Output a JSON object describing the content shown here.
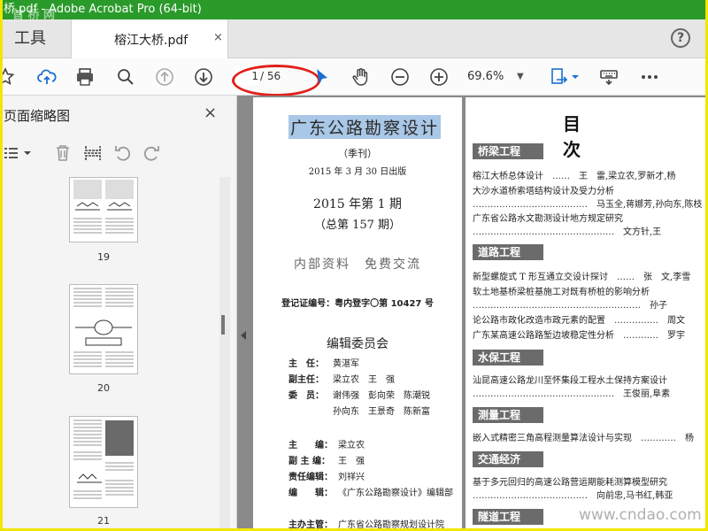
{
  "window": {
    "title": "桥.pdf - Adobe Acrobat Pro (64-bit)"
  },
  "tabs": {
    "tools": "工具",
    "document": "榕江大桥.pdf",
    "close": "×",
    "help": "?"
  },
  "toolbar": {
    "current_page": "1",
    "total_pages": "/ 56",
    "zoom": "69.6%"
  },
  "left_panel": {
    "title": "页面缩略图",
    "close": "×",
    "thumbnails": [
      {
        "page": "19"
      },
      {
        "page": "20"
      },
      {
        "page": "21"
      }
    ]
  },
  "page_left": {
    "title": "广东公路勘察设计",
    "frequency": "（季刊）",
    "date": "2015 年 3 月 30 日出版",
    "issue": "2015 年第 1 期",
    "total_issue": "（总第 157 期）",
    "notice": "内部资料　免费交流",
    "reg_no": "登记证编号：粤内登字〇第 10427 号",
    "committee_title": "编辑委员会",
    "rows": [
      {
        "label": "主　任：",
        "value": "黄湛军"
      },
      {
        "label": "副主任：",
        "value": "梁立农　王　强"
      },
      {
        "label": "委　员：",
        "value": "谢伟强　彭向荣　陈潮锐"
      },
      {
        "label": "",
        "value": "孙向东　王景奇　陈新富"
      },
      {
        "label": "主　　编：",
        "value": "梁立农"
      },
      {
        "label": "副 主 编：",
        "value": "王　强"
      },
      {
        "label": "责任编辑：",
        "value": "刘祥兴"
      },
      {
        "label": "编　　辑：",
        "value": "《广东公路勘察设计》编辑部"
      },
      {
        "label": "主办主管：",
        "value": "广东省公路勘察规划设计院"
      }
    ]
  },
  "page_right": {
    "title": "目　次",
    "sections": [
      {
        "name": "桥梁工程",
        "lines": [
          "榕江大桥总体设计　……　王　雷,梁立农,罗新才,杨",
          "大沙水道桥索塔结构设计及受力分析",
          "…………………………………　马玉全,蒋娜芳,孙向东,陈枝",
          "广东省公路水文勘测设计地方规定研究",
          "…………………………………………　文方针,王"
        ]
      },
      {
        "name": "道路工程",
        "lines": [
          "新型螺旋式 T 形互通立交设计探讨　……　张　文,李雪",
          "软土地基桥梁桩基施工对既有桥桩的影响分析",
          "…………………………………………………　孙子",
          "论公路市政化改造市政元素的配置　……………　周文",
          "广东某高速公路路堑边坡稳定性分析　…………　罗宇"
        ]
      },
      {
        "name": "水保工程",
        "lines": [
          "汕昆高速公路龙川至怀集段工程水土保持方案设计",
          "…………………………………………　王俊丽,阜素"
        ]
      },
      {
        "name": "测量工程",
        "lines": [
          "嵌入式精密三角高程测量算法设计与实现　…………　杨"
        ]
      },
      {
        "name": "交通经济",
        "lines": [
          "基于多元回归的高速公路营运期能耗测算模型研究",
          "…………………………………　向前忠,马书红,韩亚"
        ]
      },
      {
        "name": "隧道工程",
        "lines": []
      }
    ]
  },
  "watermark": "www.cndao.com",
  "logo_text": "首 桥 网"
}
